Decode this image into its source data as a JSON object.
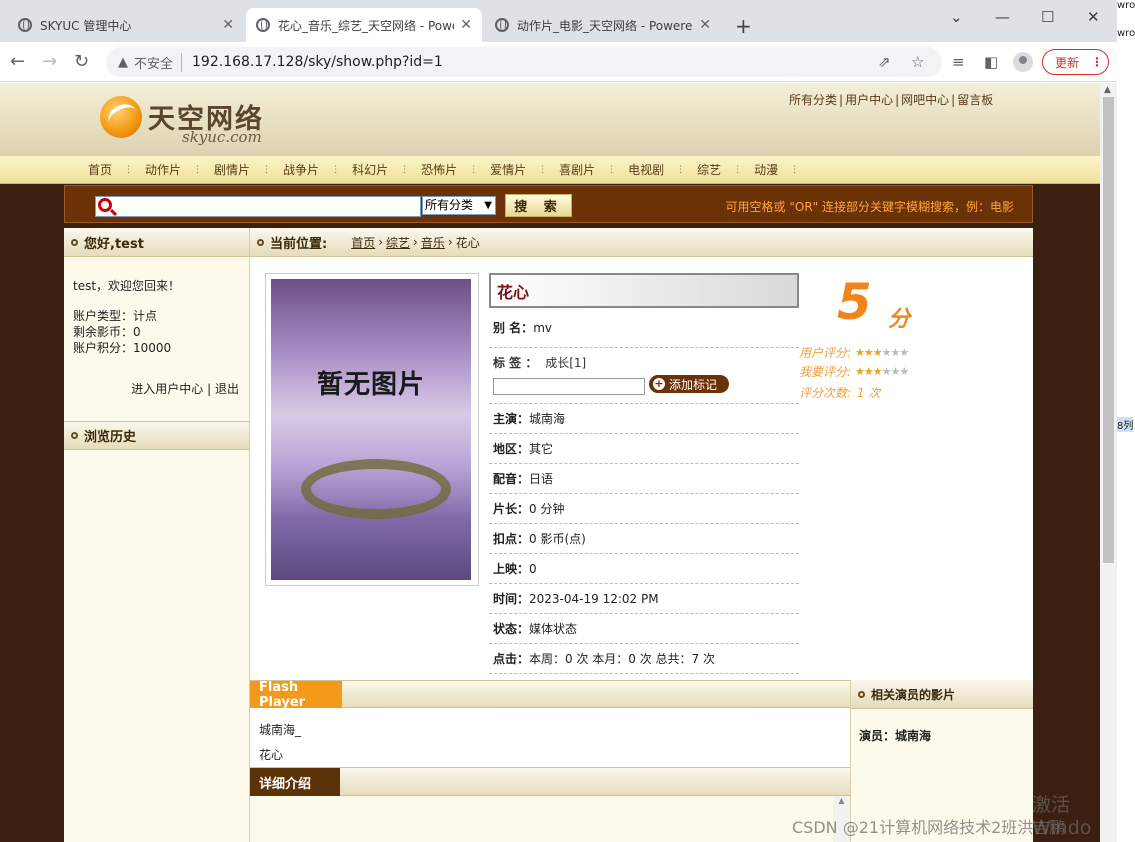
{
  "browser": {
    "tabs": [
      {
        "title": "SKYUC 管理中心",
        "active": false
      },
      {
        "title": "花心_音乐_综艺_天空网络 - Powe",
        "active": true
      },
      {
        "title": "动作片_电影_天空网络 - Powered",
        "active": false
      }
    ],
    "security_label": "不安全",
    "url": "192.168.17.128/sky/show.php?id=1",
    "update_label": "更新",
    "edge_text": [
      "wro",
      "wro",
      "8列"
    ]
  },
  "site": {
    "logo_text": "天空网络",
    "logo_sub": "skyuc.com",
    "top_links": [
      "所有分类",
      "用户中心",
      "网吧中心",
      "留言板"
    ],
    "menu": [
      "首页",
      "动作片",
      "剧情片",
      "战争片",
      "科幻片",
      "恐怖片",
      "爱情片",
      "喜剧片",
      "电视剧",
      "综艺",
      "动漫"
    ],
    "search": {
      "select_value": "所有分类",
      "button_label": "搜 索",
      "hint": "可用空格或 \"OR\" 连接部分关键字模糊搜索，例：电影"
    }
  },
  "sidebar": {
    "greeting_title": "您好,test",
    "welcome": "test，欢迎您回来！",
    "account_type": "账户类型：计点",
    "remaining": "剩余影币：0",
    "points": "账户积分：10000",
    "user_center_link": "进入用户中心",
    "logout_link": "退出",
    "history_title": "浏览历史"
  },
  "breadcrumb": {
    "label": "当前位置:",
    "items": [
      "首页",
      "综艺",
      "音乐"
    ],
    "current": "花心"
  },
  "movie": {
    "poster_text": "暂无图片",
    "title": "花心",
    "alias_label": "别 名：",
    "alias": "mv",
    "tags_label": "标 签 ：",
    "tag": "成长[1]",
    "add_tag_label": "添加标记",
    "rows": [
      {
        "label": "主演：",
        "value": "城南海"
      },
      {
        "label": "地区：",
        "value": "其它"
      },
      {
        "label": "配音：",
        "value": "日语"
      },
      {
        "label": "片长：",
        "value": "0 分钟"
      },
      {
        "label": "扣点：",
        "value": "0 影币(点)"
      },
      {
        "label": "上映：",
        "value": "0"
      },
      {
        "label": "时间：",
        "value": "2023-04-19 12:02 PM"
      },
      {
        "label": "状态：",
        "value": "媒体状态"
      },
      {
        "label": "点击：",
        "value": "本周：0 次 本月：0 次 总共：7 次"
      }
    ]
  },
  "rating": {
    "score": "5",
    "unit": "分",
    "user_rating_label": "用户评分:",
    "my_rating_label": "我要评分:",
    "count_label": "评分次数:",
    "count_value": "1 次",
    "stars_filled": 3,
    "stars_total": 6
  },
  "flash": {
    "tab_label": "Flash Player",
    "items": [
      "城南海_",
      "花心"
    ]
  },
  "detail": {
    "tab_label": "详细介绍"
  },
  "actors": {
    "title": "相关演员的影片",
    "line": "演员：城南海"
  },
  "watermarks": {
    "activate": "激活 Windo",
    "csdn": "CSDN @21计算机网络技术2班洪吉鹏"
  }
}
